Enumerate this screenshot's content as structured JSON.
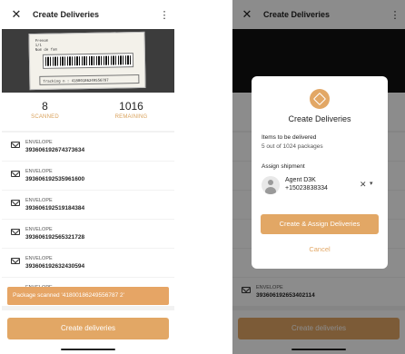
{
  "left_screen": {
    "header": {
      "title": "Create Deliveries",
      "close_icon": "close-icon",
      "more_icon": "kebab-menu-icon"
    },
    "camera_label": {
      "lines": [
        "Prenom",
        "1/1",
        "Nom de fam"
      ],
      "tracking": "Tracking n : 41800186249556787"
    },
    "stats": {
      "scanned_value": "8",
      "scanned_label": "SCANNED",
      "remaining_value": "1016",
      "remaining_label": "REMAINING"
    },
    "items": [
      {
        "type": "ENVELOPE",
        "number": "393606192674373634"
      },
      {
        "type": "ENVELOPE",
        "number": "393606192535961600"
      },
      {
        "type": "ENVELOPE",
        "number": "393606192519184384"
      },
      {
        "type": "ENVELOPE",
        "number": "393606192565321728"
      },
      {
        "type": "ENVELOPE",
        "number": "393606192632430594"
      },
      {
        "type": "ENVELOPE",
        "number": ""
      }
    ],
    "snackbar": "Package scanned '41800186249556787 2'",
    "create_button": "Create deliveries"
  },
  "right_screen": {
    "header": {
      "title": "Create Deliveries"
    },
    "dialog": {
      "title": "Create Deliveries",
      "items_heading": "Items to be delivered",
      "items_text": "5 out of 1024 packages",
      "assign_heading": "Assign shipment",
      "agent_name": "Agent D3K",
      "agent_phone": "+15023838334",
      "primary_button": "Create & Assign Deliveries",
      "cancel_button": "Cancel"
    },
    "visible_item": {
      "type": "ENVELOPE",
      "number": "393606192653402114"
    },
    "create_button": "Create deliveries"
  },
  "colors": {
    "accent": "#e2a765",
    "scrim": "rgba(0,0,0,0.45)"
  }
}
